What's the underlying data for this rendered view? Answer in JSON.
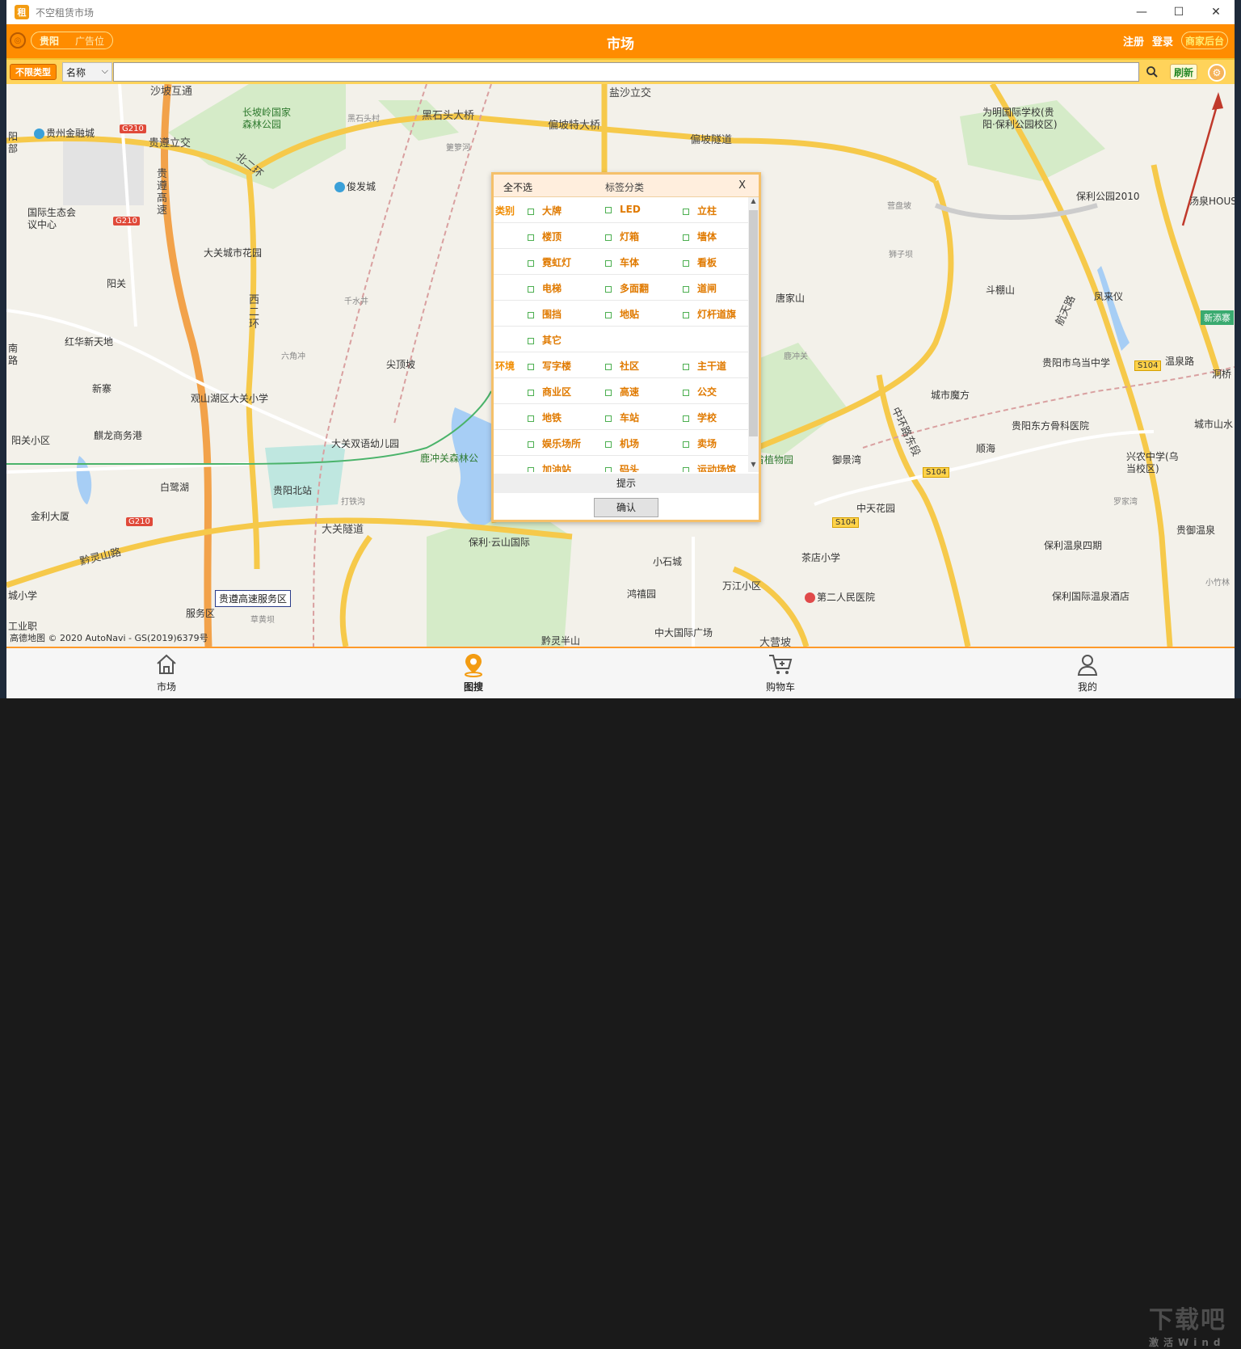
{
  "window": {
    "title": "不空租赁市场",
    "controls": [
      "—",
      "☐",
      "✕"
    ]
  },
  "header": {
    "city": "贵阳",
    "ad_label": "广告位",
    "title": "市场",
    "register": "注册",
    "login": "登录",
    "merchant": "商家后台"
  },
  "search": {
    "type_button": "不限类型",
    "field": "名称",
    "value": "",
    "refresh": "刷新"
  },
  "map": {
    "copyright": "高德地图 © 2020 AutoNavi - GS(2019)6379号",
    "service_area_label": "贵遵高速服务区",
    "badges": {
      "g210": "G210",
      "s104": "S104",
      "xintian": "新添寨"
    },
    "pois": [
      "沙坡互通",
      "长坡岭国家森林公园",
      "黑石头村",
      "黑石头大桥",
      "偏坡特大桥",
      "盐沙立交",
      "偏坡隧道",
      "筻箩河",
      "贵州金融城",
      "贵遵立交",
      "俊发城",
      "北二环",
      "国际生态会议中心",
      "贵遵高速",
      "大关城市花园",
      "阳关",
      "红华新天地",
      "新寨",
      "西二环",
      "千水井",
      "六角冲",
      "尖顶坡",
      "观山湖区大关小学",
      "麒龙商务港",
      "大关双语幼儿园",
      "阳关小区",
      "白鹭湖",
      "贵阳北站",
      "打铁沟",
      "金利大厦",
      "大关隧道",
      "黔灵山路",
      "鹿冲关森林公",
      "保利·云山国际",
      "服务区",
      "草黄坝",
      "为明国际学校(贵阳·保利公园校区)",
      "保利公园2010",
      "汤泉HOUSE",
      "营盘坡",
      "狮子坝",
      "唐家山",
      "斗棚山",
      "凤来仪",
      "鹿冲关",
      "贵阳市乌当中学",
      "温泉路",
      "城市魔方",
      "贵阳东方骨科医院",
      "顺海",
      "兴农中学(乌当校区)",
      "御景湾",
      "中天花园",
      "省植物园",
      "茶店小学",
      "保利温泉四期",
      "贵御温泉",
      "保利国际温泉酒店",
      "第二人民医院",
      "万江小区",
      "小石城",
      "鸿禧园",
      "中大国际广场",
      "黔灵半山",
      "大营坡",
      "中环路东段",
      "航天路",
      "洞桥",
      "城市山水",
      "罗家湾",
      "小竹林",
      "南路",
      "阳部",
      "城小学",
      "工业职"
    ]
  },
  "dialog": {
    "select_all": "全不选",
    "title": "标签分类",
    "close": "X",
    "rows": [
      {
        "cat": "类别",
        "opts": [
          "大牌",
          "LED",
          "立柱"
        ]
      },
      {
        "cat": "",
        "opts": [
          "楼顶",
          "灯箱",
          "墙体"
        ]
      },
      {
        "cat": "",
        "opts": [
          "霓虹灯",
          "车体",
          "看板"
        ]
      },
      {
        "cat": "",
        "opts": [
          "电梯",
          "多面翻",
          "道闸"
        ]
      },
      {
        "cat": "",
        "opts": [
          "围挡",
          "地贴",
          "灯杆道旗"
        ]
      },
      {
        "cat": "",
        "opts": [
          "其它",
          "",
          ""
        ]
      },
      {
        "cat": "环境",
        "opts": [
          "写字楼",
          "社区",
          "主干道"
        ]
      },
      {
        "cat": "",
        "opts": [
          "商业区",
          "高速",
          "公交"
        ]
      },
      {
        "cat": "",
        "opts": [
          "地铁",
          "车站",
          "学校"
        ]
      },
      {
        "cat": "",
        "opts": [
          "娱乐场所",
          "机场",
          "卖场"
        ]
      },
      {
        "cat": "",
        "opts": [
          "加油站",
          "码头",
          "运动场馆"
        ]
      }
    ],
    "hint": "提示",
    "ok": "确认"
  },
  "nav": [
    {
      "label": "市场",
      "icon": "home-icon"
    },
    {
      "label": "图搜",
      "icon": "map-pin-icon",
      "active": true
    },
    {
      "label": "购物车",
      "icon": "cart-icon"
    },
    {
      "label": "我的",
      "icon": "user-icon"
    }
  ],
  "watermark": {
    "main": "下载吧",
    "sub": "激活Wind"
  },
  "colors": {
    "header": "#ff8c00",
    "searchbar": "#ffd35a",
    "accent_text": "#e07a00"
  }
}
